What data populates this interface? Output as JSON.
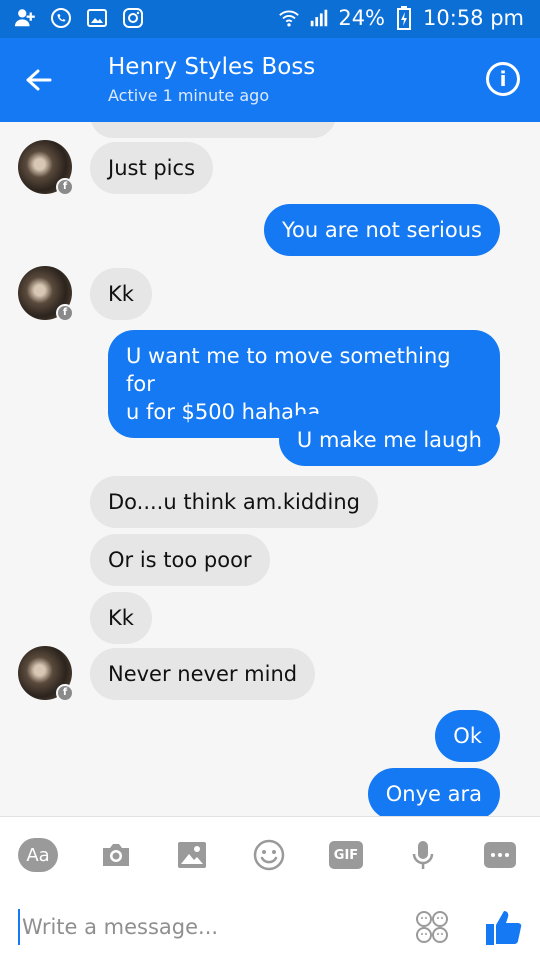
{
  "status_bar": {
    "battery": "24%",
    "time": "10:58 pm"
  },
  "header": {
    "contact_name": "Henry Styles Boss",
    "status": "Active 1 minute ago"
  },
  "messages": [
    {
      "side": "in",
      "text": "Just pics"
    },
    {
      "side": "out",
      "text": "You are not serious"
    },
    {
      "side": "in",
      "text": "Kk"
    },
    {
      "side": "out",
      "text": "U want me to move something for",
      "text2": "u for $500 hahaha"
    },
    {
      "side": "out",
      "text": "U make me laugh"
    },
    {
      "side": "in",
      "text": "Do....u think am.kidding"
    },
    {
      "side": "in",
      "text": "Or is too poor"
    },
    {
      "side": "in",
      "text": "Kk"
    },
    {
      "side": "in",
      "text": "Never never mind"
    },
    {
      "side": "out",
      "text": "Ok"
    },
    {
      "side": "out",
      "text": "Onye ara"
    }
  ],
  "composer": {
    "aa_label": "Aa",
    "gif_label": "GIF",
    "placeholder": "Write a message..."
  },
  "colors": {
    "brand_blue": "#1479f3",
    "status_blue": "#0c6fd6",
    "incoming_bubble": "#e6e6e6"
  },
  "icons": [
    "add-user-icon",
    "whatsapp-icon",
    "gallery-icon",
    "instagram-icon",
    "wifi-icon",
    "signal-icon",
    "battery-charging-icon",
    "back-arrow-icon",
    "info-icon",
    "camera-icon",
    "image-icon",
    "emoji-icon",
    "gif-icon",
    "microphone-icon",
    "more-icon",
    "sticker-icon",
    "like-icon"
  ]
}
